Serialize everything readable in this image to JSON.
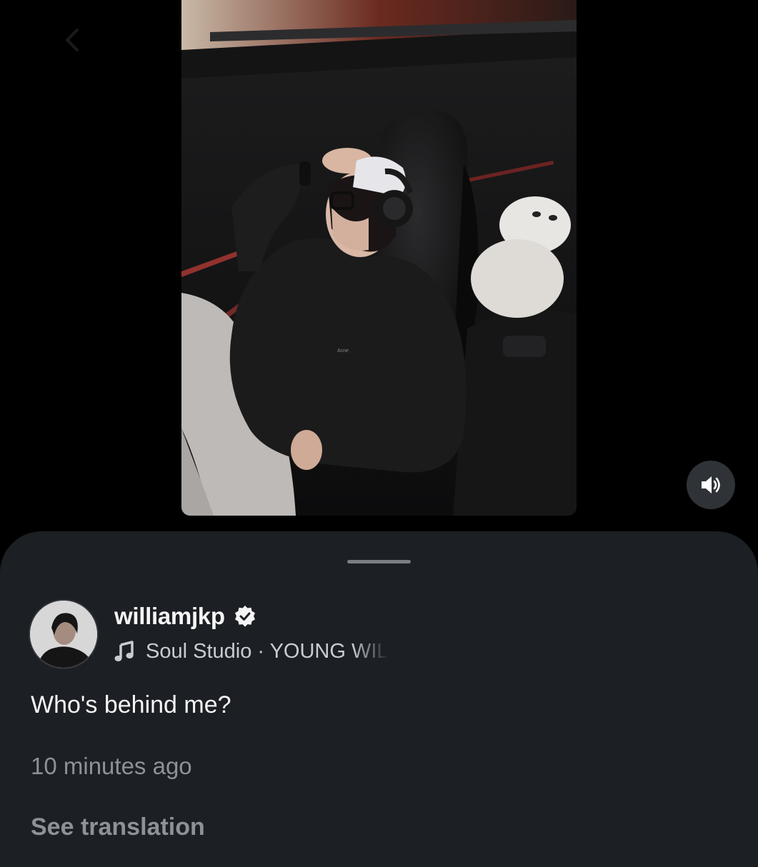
{
  "post": {
    "username": "williamjkp",
    "audio": {
      "source": "Soul Studio",
      "separator": " · ",
      "title": "YOUNG WIL"
    },
    "caption": "Who's behind me?",
    "timestamp": "10 minutes ago",
    "translate_label": "See translation"
  },
  "icons": {
    "back": "back-arrow-icon",
    "sound": "speaker-icon",
    "verified": "verified-badge-icon",
    "music": "music-note-icon"
  },
  "colors": {
    "background": "#000000",
    "sheet": "#1c1f23",
    "text_primary": "#f5f5f5",
    "text_secondary": "#8e9197"
  }
}
